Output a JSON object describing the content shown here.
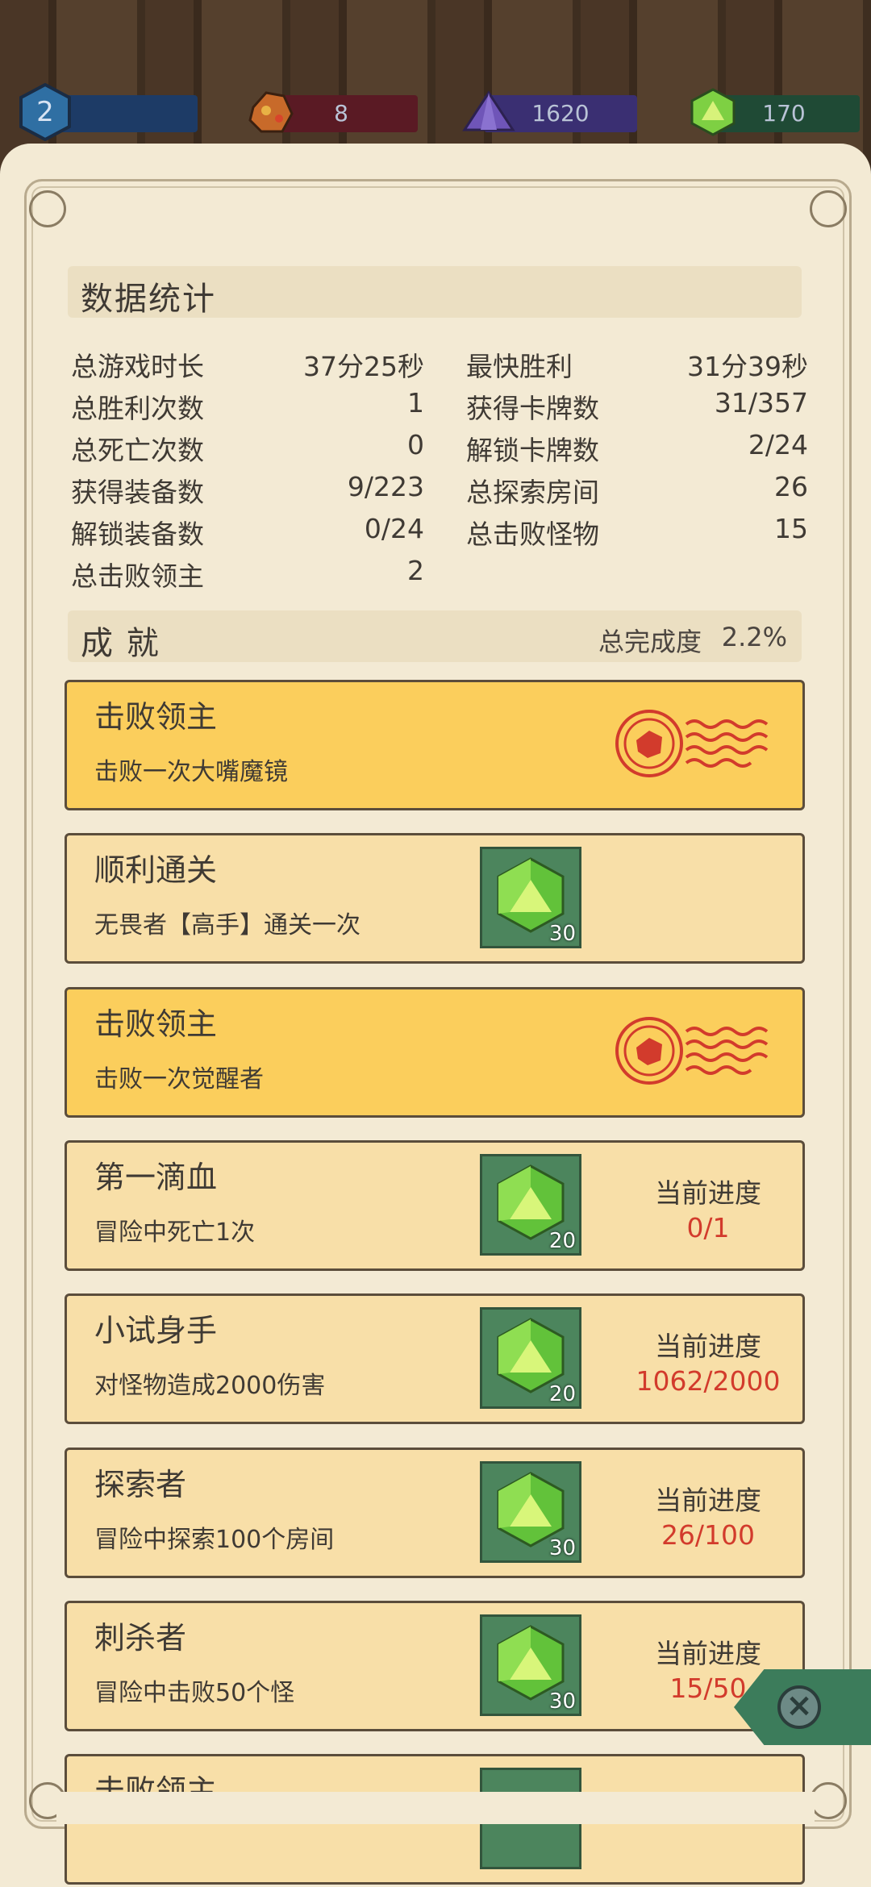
{
  "resources": {
    "level": "2",
    "red": "8",
    "purple": "1620",
    "green": "170"
  },
  "stats": {
    "title": "数据统计",
    "left": [
      {
        "label": "总游戏时长",
        "value": "37分25秒"
      },
      {
        "label": "总胜利次数",
        "value": "1"
      },
      {
        "label": "总死亡次数",
        "value": "0"
      },
      {
        "label": "获得装备数",
        "value": "9/223"
      },
      {
        "label": "解锁装备数",
        "value": "0/24"
      },
      {
        "label": "总击败领主",
        "value": "2"
      }
    ],
    "right": [
      {
        "label": "最快胜利",
        "value": "31分39秒"
      },
      {
        "label": "获得卡牌数",
        "value": "31/357"
      },
      {
        "label": "解锁卡牌数",
        "value": "2/24"
      },
      {
        "label": "总探索房间",
        "value": "26"
      },
      {
        "label": "总击败怪物",
        "value": "15"
      }
    ]
  },
  "achievements": {
    "title": "成 就",
    "completion_label": "总完成度",
    "completion_value": "2.2%",
    "progress_label": "当前进度",
    "cards": [
      {
        "title": "击败领主",
        "desc": "击败一次大嘴魔镜",
        "style": "gold",
        "stamp": true
      },
      {
        "title": "顺利通关",
        "desc": "无畏者【高手】通关一次",
        "style": "plain",
        "reward": "30"
      },
      {
        "title": "击败领主",
        "desc": "击败一次觉醒者",
        "style": "gold",
        "stamp": true
      },
      {
        "title": "第一滴血",
        "desc": "冒险中死亡1次",
        "style": "plain",
        "reward": "20",
        "progress": "0/1"
      },
      {
        "title": "小试身手",
        "desc": "对怪物造成2000伤害",
        "style": "plain",
        "reward": "20",
        "progress": "1062/2000"
      },
      {
        "title": "探索者",
        "desc": "冒险中探索100个房间",
        "style": "plain",
        "reward": "30",
        "progress": "26/100"
      },
      {
        "title": "刺杀者",
        "desc": "冒险中击败50个怪",
        "style": "plain",
        "reward": "30",
        "progress": "15/50"
      },
      {
        "title": "击败领主",
        "desc": "",
        "style": "plain",
        "reward": ""
      }
    ]
  },
  "icons": {
    "close": "close-icon",
    "gem": "green-gem-icon",
    "stamp": "wax-stamp-icon"
  },
  "colors": {
    "parchment": "#f3ead4",
    "card_plain": "#f8dfa8",
    "card_gold": "#fbce5c",
    "progress_red": "#d23b2c",
    "reward_green": "#4c855d"
  }
}
